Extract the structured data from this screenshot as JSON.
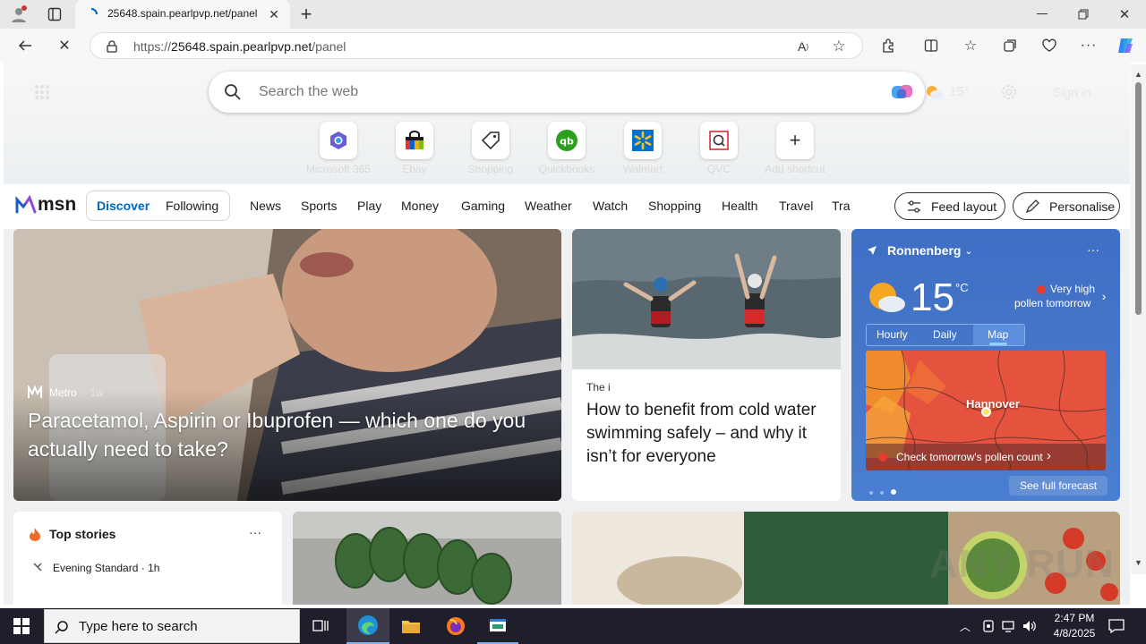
{
  "browser": {
    "tab_title": "25648.spain.pearlpvp.net/panel",
    "new_tab_label": "+",
    "url_prefix": "https://",
    "url_host": "25648.spain.pearlpvp.net",
    "url_path": "/panel"
  },
  "newtab": {
    "search_placeholder": "Search the web",
    "weather_temp_small": "15°",
    "sign_in": "Sign in",
    "shortcuts": [
      {
        "label": "Microsoft 365"
      },
      {
        "label": "Ebay"
      },
      {
        "label": "Shopping"
      },
      {
        "label": "Quickbooks"
      },
      {
        "label": "Walmart"
      },
      {
        "label": "QVC"
      },
      {
        "label": "Add shortcut"
      }
    ]
  },
  "msn": {
    "logo": "msn",
    "tabs": [
      "Discover",
      "Following"
    ],
    "nav": [
      "News",
      "Sports",
      "Play",
      "Money",
      "Gaming",
      "Weather",
      "Watch",
      "Shopping",
      "Health",
      "Travel",
      "Tra"
    ],
    "feed_layout": "Feed layout",
    "personalise": "Personalise"
  },
  "hero": {
    "source": "Metro",
    "age": "· 1w",
    "headline": "Paracetamol, Aspirin or Ibuprofen — which one do you actually need to take?"
  },
  "story2": {
    "source": "The i",
    "headline": "How to benefit from cold water swimming safely – and why it isn’t for everyone"
  },
  "weather": {
    "location": "Ronnenberg",
    "temp": "15",
    "unit": "°C",
    "pollen_line1": "Very high",
    "pollen_line2": "pollen tomorrow",
    "tabs": [
      "Hourly",
      "Daily",
      "Map"
    ],
    "map_city": "Hannover",
    "pollen_link": "Check tomorrow's pollen count",
    "forecast_link": "See full forecast"
  },
  "top_stories": {
    "title": "Top stories",
    "source": "Evening Standard · 1h"
  },
  "taskbar": {
    "search_placeholder": "Type here to search",
    "time": "2:47 PM",
    "date": "4/8/2025"
  },
  "watermark": "ANY RUN",
  "colors": {
    "accent": "#0067c0",
    "weather_card": "#4472c4",
    "map_red": "#e5533e"
  }
}
